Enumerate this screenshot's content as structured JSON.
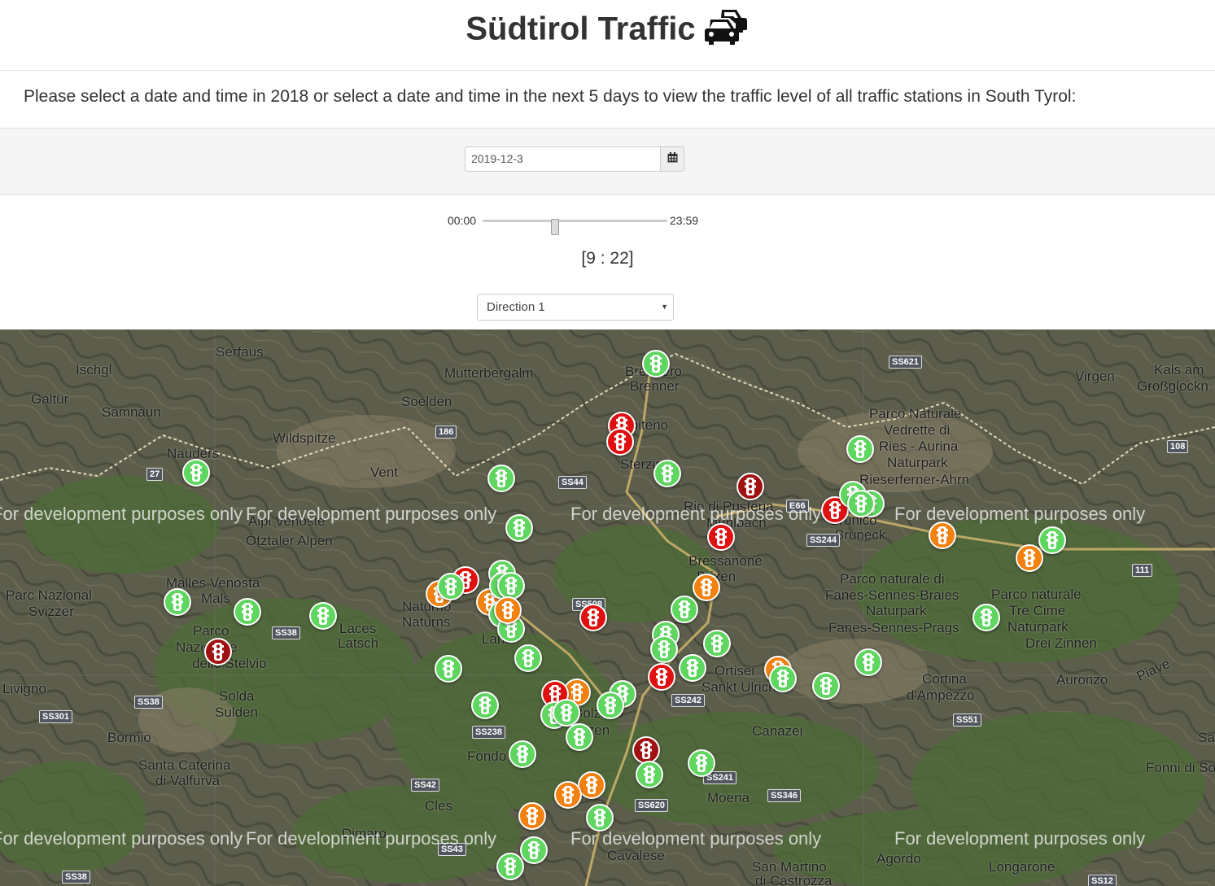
{
  "header": {
    "title": "Südtirol Traffic"
  },
  "intro": {
    "text": "Please select a date and time in 2018 or select a date and time in the next 5 days to view the traffic level of all traffic stations in South Tyrol:"
  },
  "date_picker": {
    "value": "2019-12-3",
    "icon": "calendar-icon"
  },
  "time_slider": {
    "min_label": "00:00",
    "max_label": "23:59",
    "value_fraction": 0.39,
    "display": "[9 : 22]"
  },
  "direction_select": {
    "selected": "Direction 1"
  },
  "map": {
    "watermark": "For development purposes only",
    "places": [
      "Serfaus",
      "Ischgl",
      "Galtür",
      "Samnaun",
      "Mutterbergalm",
      "Soelden",
      "Wildspitze",
      "Vent",
      "Nauders",
      "Brennero",
      "Brenner",
      "Vipiteno",
      "Sterzing",
      "Ötztaler Alpen",
      "Alpi Venoste",
      "Parco Naturale",
      "Vedrette di",
      "Ries - Aurina",
      "Naturpark",
      "Rieserferner-Ahrn",
      "Virgen",
      "Kals am",
      "Großglockn",
      "Malles Venosta",
      "Mals",
      "Parc Nazional",
      "Svizzer",
      "Laces",
      "Latsch",
      "Naturno",
      "Naturns",
      "Bressanone",
      "Brixen",
      "Rio di Pusteria",
      "Mühlbach",
      "Brunico",
      "Bruneck",
      "Parco naturale di",
      "Fanes-Sennes-Braies",
      "Naturpark",
      "Fanes-Sennes-Prags",
      "Parco naturale",
      "Tre Cime",
      "Naturpark",
      "Drei Zinnen",
      "Parco",
      "Nazionale",
      "dello Stelvio",
      "Solda",
      "Sulden",
      "Livigno",
      "Lana",
      "Ortisei",
      "Sankt Ulrich",
      "Cortina",
      "d'Ampezzo",
      "Auronzo",
      "Piave",
      "Bormio",
      "Santa Caterina",
      "di Valfurva",
      "Fondo",
      "Bolzano",
      "Bozen",
      "Canazei",
      "Fonni di Sopra",
      "Cles",
      "Moena",
      "Dimaro",
      "Cavalese",
      "Agordo",
      "Longarone",
      "San Martino",
      "di Castrozza",
      "Sau"
    ],
    "roads": [
      "SS621",
      "186",
      "27",
      "SS44",
      "E66",
      "SS244",
      "108",
      "111",
      "SS38",
      "SS508",
      "SS242",
      "SS38",
      "SS301",
      "SS238",
      "SS42",
      "SS241",
      "SS346",
      "SS620",
      "SS51",
      "SS43",
      "SS38",
      "SS12"
    ],
    "station_status_colors": {
      "green": "#5ed660",
      "orange": "#f2810f",
      "red": "#e01010",
      "darkred": "#a01212"
    },
    "station_icon": "traffic-light-icon",
    "stations": [
      {
        "status": "green"
      },
      {
        "status": "red"
      },
      {
        "status": "red"
      },
      {
        "status": "green"
      },
      {
        "status": "green"
      },
      {
        "status": "green"
      },
      {
        "status": "darkred"
      },
      {
        "status": "green"
      },
      {
        "status": "red"
      },
      {
        "status": "red"
      },
      {
        "status": "green"
      },
      {
        "status": "green"
      },
      {
        "status": "green"
      },
      {
        "status": "orange"
      },
      {
        "status": "green"
      },
      {
        "status": "orange"
      },
      {
        "status": "green"
      },
      {
        "status": "red"
      },
      {
        "status": "green"
      },
      {
        "status": "orange"
      },
      {
        "status": "red"
      },
      {
        "status": "green"
      },
      {
        "status": "orange"
      },
      {
        "status": "orange"
      },
      {
        "status": "green"
      },
      {
        "status": "green"
      },
      {
        "status": "green"
      },
      {
        "status": "green"
      },
      {
        "status": "darkred"
      },
      {
        "status": "red"
      },
      {
        "status": "green"
      },
      {
        "status": "green"
      },
      {
        "status": "green"
      },
      {
        "status": "green"
      },
      {
        "status": "green"
      },
      {
        "status": "green"
      },
      {
        "status": "green"
      },
      {
        "status": "green"
      },
      {
        "status": "orange"
      },
      {
        "status": "green"
      },
      {
        "status": "green"
      },
      {
        "status": "green"
      },
      {
        "status": "red"
      },
      {
        "status": "green"
      },
      {
        "status": "green"
      },
      {
        "status": "orange"
      },
      {
        "status": "red"
      },
      {
        "status": "orange"
      },
      {
        "status": "green"
      },
      {
        "status": "green"
      },
      {
        "status": "green"
      },
      {
        "status": "green"
      },
      {
        "status": "green"
      },
      {
        "status": "green"
      },
      {
        "status": "green"
      },
      {
        "status": "darkred"
      },
      {
        "status": "green"
      },
      {
        "status": "green"
      },
      {
        "status": "orange"
      },
      {
        "status": "orange"
      },
      {
        "status": "orange"
      },
      {
        "status": "green"
      },
      {
        "status": "green"
      },
      {
        "status": "green"
      },
      {
        "status": "green"
      }
    ]
  }
}
